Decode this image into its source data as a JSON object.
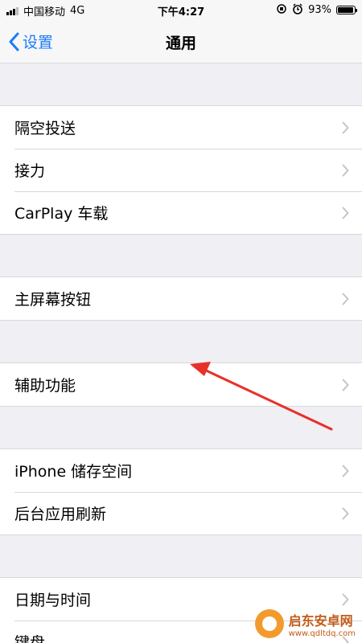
{
  "status_bar": {
    "carrier": "中国移动",
    "network": "4G",
    "time": "下午4:27",
    "battery_percent_label": "93%",
    "battery_level": 0.93
  },
  "nav": {
    "back_label": "设置",
    "title": "通用"
  },
  "groups": [
    {
      "items": [
        {
          "label": "隔空投送"
        },
        {
          "label": "接力"
        },
        {
          "label": "CarPlay 车载"
        }
      ]
    },
    {
      "items": [
        {
          "label": "主屏幕按钮"
        }
      ]
    },
    {
      "items": [
        {
          "label": "辅助功能"
        }
      ]
    },
    {
      "items": [
        {
          "label": "iPhone 储存空间"
        },
        {
          "label": "后台应用刷新"
        }
      ]
    },
    {
      "items": [
        {
          "label": "日期与时间"
        },
        {
          "label": "键盘"
        }
      ]
    }
  ],
  "watermark": {
    "title": "启东安卓网",
    "url": "www.qdltdq.com"
  },
  "colors": {
    "accent": "#1a7cf7",
    "annotation": "#e8302a",
    "background": "#efeff4"
  },
  "icons": {
    "back": "chevron-left-icon",
    "disclosure": "chevron-right-icon",
    "orientation_lock": "orientation-lock-icon",
    "alarm": "alarm-icon",
    "battery": "battery-icon"
  }
}
